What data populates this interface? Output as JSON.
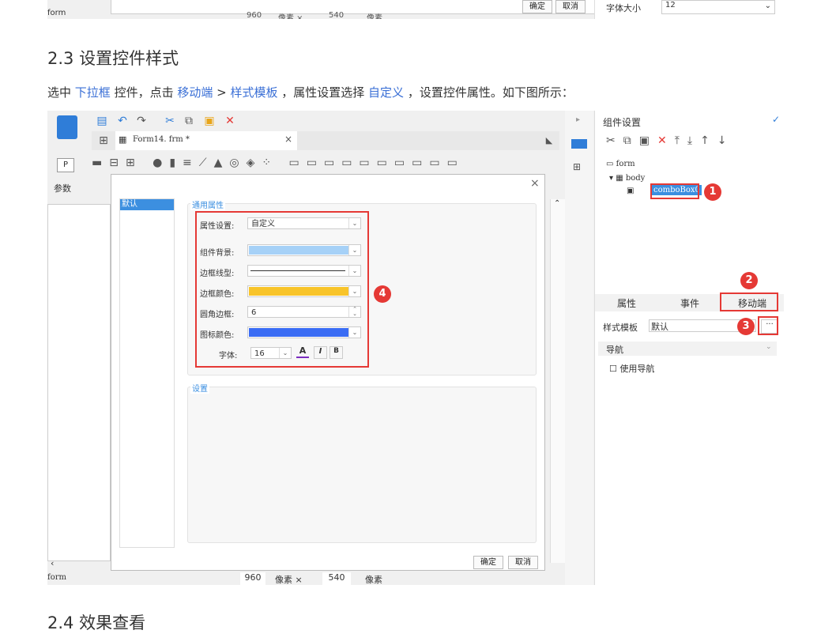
{
  "top_shot": {
    "ok": "确定",
    "cancel": "取消",
    "status_form": "form",
    "width": "960",
    "unit1": "像素 ×",
    "height": "540",
    "unit2": "像素",
    "font_size_label": "字体大小",
    "font_size_value": "12"
  },
  "heading_23": "2.3 设置控件样式",
  "para": {
    "p1": "选中 ",
    "h1": "下拉框",
    "p2": " 控件，点击 ",
    "h2": "移动端",
    "p3": " > ",
    "h3": "样式模板",
    "p4": " ，属性设置选择 ",
    "h4": "自定义",
    "p5": " ，设置控件属性。如下图所示："
  },
  "shot": {
    "tab_file": "Form14. frm *",
    "param_label": "参数",
    "status_form": "form",
    "width": "960",
    "unit1": "像素 ×",
    "height": "540",
    "unit2": "像素",
    "dialog": {
      "list_selected": "默认",
      "group1_title": "通用属性",
      "group2_title": "设置",
      "props": [
        {
          "label": "属性设置:",
          "value": "自定义"
        },
        {
          "label": "组件背景:",
          "value": ""
        },
        {
          "label": "边框线型:",
          "value": ""
        },
        {
          "label": "边框颜色:",
          "value": ""
        },
        {
          "label": "圆角边框:",
          "value": "6"
        },
        {
          "label": "图标颜色:",
          "value": ""
        }
      ],
      "font_label": "字体:",
      "font_size": "16",
      "font_btn_a": "A",
      "font_btn_i": "I",
      "font_btn_b": "B",
      "ok": "确定",
      "cancel": "取消"
    },
    "right": {
      "title": "组件设置",
      "tree_form": "form",
      "tree_body": "body",
      "tree_combo": "comboBox0",
      "tab_props": "属性",
      "tab_events": "事件",
      "tab_mobile": "移动端",
      "style_label": "样式模板",
      "style_value": "默认",
      "more": "···",
      "nav_header": "导航",
      "nav_checkbox": "使用导航"
    },
    "badges": [
      "1",
      "2",
      "3",
      "4"
    ]
  },
  "colors": {
    "link": "#3a6fd6",
    "highlight_red": "#e53935",
    "bg_light_blue": "#a6d1f7",
    "border_yellow": "#f8c42a",
    "icon_blue": "#3a6cf4",
    "selection_blue": "#3c8fe0"
  },
  "heading_24": "2.4 效果查看"
}
